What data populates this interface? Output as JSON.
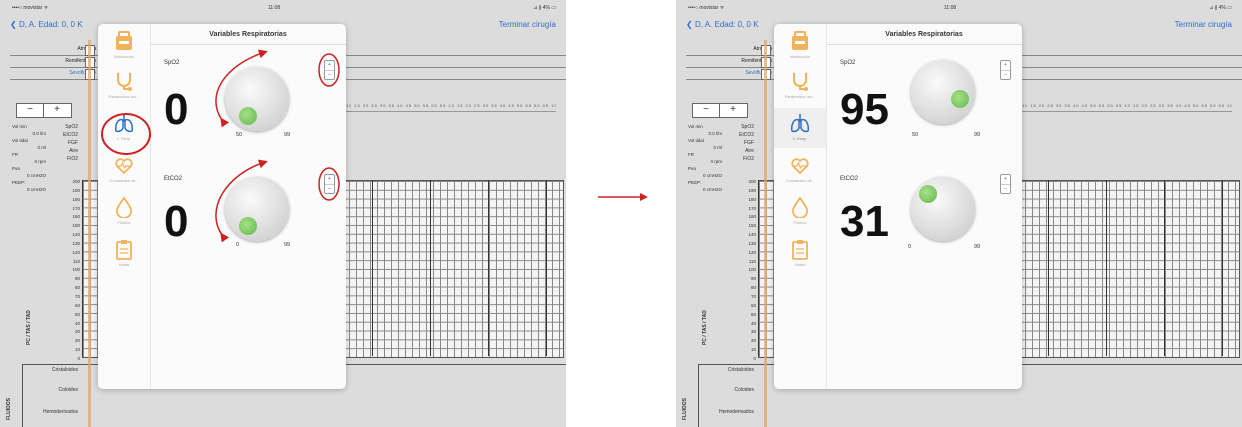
{
  "colors": {
    "accent": "#2f6fc9",
    "annotation": "#cc2222",
    "knob_dot": "#6cc24a",
    "fluid_line": "#e0a66a"
  },
  "screens": [
    {
      "status": {
        "carrier": "••••○ movistar ᯤ",
        "time": "11:08",
        "battery": "⊿ ∦ 4% ▭"
      },
      "nav": {
        "back": "D, A. Edad: 0, 0 K",
        "finish": "Terminar cirugía"
      },
      "drugs": [
        "Atropina",
        "Remifentanilo",
        "Sevoflurano"
      ],
      "time_axis": "11 15 20 25 30 35 40 45 50 55 00 05 10 15 20 25 30 35 40 45 50 55 00 05 10 15 20 25 30 35 40 45 50",
      "params": [
        "Vol min",
        "0.0 l/m",
        "Vol tidal",
        "0 ml",
        "FR",
        "0 rpm",
        "Pva",
        "0 cmH2O",
        "PEEP:",
        "0 cmH2O"
      ],
      "labels": [
        "SpO2",
        "EtCO2",
        "FGF",
        "Aire",
        "FiO2"
      ],
      "y_axis": [
        "200",
        "190",
        "180",
        "170",
        "160",
        "150",
        "140",
        "130",
        "120",
        "110",
        "100",
        "90",
        "80",
        "70",
        "60",
        "50",
        "40",
        "30",
        "20",
        "10",
        "0"
      ],
      "y_label": "PC / TAS / TAD",
      "fluids": [
        "Cristaloides",
        "Coloides",
        "Hemoderivados"
      ],
      "fluids_label": "FLUIDOS",
      "popover": {
        "title": "Variables Respiratorias",
        "menu": [
          {
            "label": "Medicación",
            "icon": "medication-box-icon"
          },
          {
            "label": "Parámetros res...",
            "icon": "stethoscope-icon"
          },
          {
            "label": "V. Resp.",
            "icon": "lungs-icon"
          },
          {
            "label": "Constantes vit...",
            "icon": "heart-rate-icon"
          },
          {
            "label": "Fluidos",
            "icon": "drop-icon"
          },
          {
            "label": "Notas",
            "icon": "clipboard-icon"
          }
        ],
        "spo2": {
          "name": "SpO2",
          "value": "0",
          "min": "50",
          "max": "99"
        },
        "etco2": {
          "name": "EtCO2",
          "value": "0",
          "min": "0",
          "max": "99"
        },
        "plus": "+",
        "minus": "–"
      }
    },
    {
      "status": {
        "carrier": "••••○ movistar ᯤ",
        "time": "11:08",
        "battery": "⊿ ∦ 4% ▭"
      },
      "nav": {
        "back": "D, A. Edad: 0, 0 K",
        "finish": "Terminar cirugía"
      },
      "drugs": [
        "Atropina",
        "Remifentanilo",
        "Sevoflurano"
      ],
      "time_axis": "11 15 20 25 30 35 40 45 50 55 00 05 10 15 20 25 30 35 40 45 50 55 00 05 10 15 20 25 30 35 40 45 50",
      "params": [
        "Vol min",
        "0.0 l/m",
        "Vol tidal",
        "0 ml",
        "FR",
        "0 rpm",
        "Pva",
        "0 cmH2O",
        "PEEP:",
        "0 cmH2O"
      ],
      "labels": [
        "SpO2",
        "EtCO2",
        "FGF",
        "Aire",
        "FiO2"
      ],
      "y_axis": [
        "200",
        "190",
        "180",
        "170",
        "160",
        "150",
        "140",
        "130",
        "120",
        "110",
        "100",
        "90",
        "80",
        "70",
        "60",
        "50",
        "40",
        "30",
        "20",
        "10",
        "0"
      ],
      "y_label": "PC / TAS / TAD",
      "fluids": [
        "Cristaloides",
        "Coloides",
        "Hemoderivados"
      ],
      "fluids_label": "FLUIDOS",
      "popover": {
        "title": "Variables Respiratorias",
        "menu": [
          {
            "label": "Medicación",
            "icon": "medication-box-icon"
          },
          {
            "label": "Parámetros res...",
            "icon": "stethoscope-icon"
          },
          {
            "label": "V. Resp.",
            "icon": "lungs-icon"
          },
          {
            "label": "Constantes vit...",
            "icon": "heart-rate-icon"
          },
          {
            "label": "Fluidos",
            "icon": "drop-icon"
          },
          {
            "label": "Notas",
            "icon": "clipboard-icon"
          }
        ],
        "spo2": {
          "name": "SpO2",
          "value": "95",
          "min": "50",
          "max": "99"
        },
        "etco2": {
          "name": "EtCO2",
          "value": "31",
          "min": "0",
          "max": "99"
        },
        "plus": "+",
        "minus": "–"
      }
    }
  ]
}
